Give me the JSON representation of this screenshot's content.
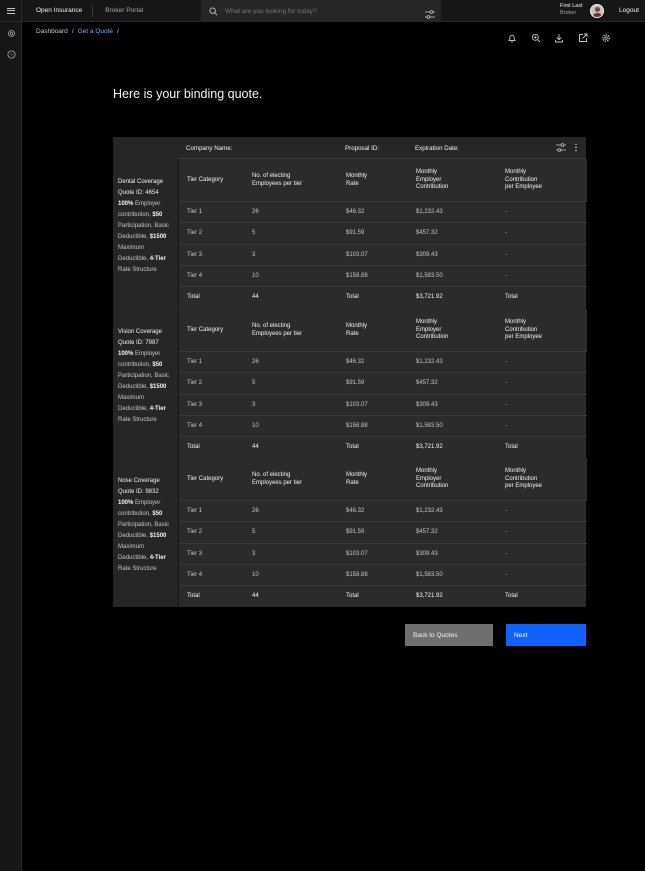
{
  "header": {
    "brand": "Open Insurance",
    "portal": "Broker Portal",
    "search_placeholder": "What are you looking for today?",
    "user_name": "First Last",
    "user_role": "Broker",
    "logout_label": "Logout"
  },
  "breadcrumb": {
    "items": [
      "Dashboard",
      "/",
      "Get a Quote",
      "/"
    ]
  },
  "page": {
    "title": "Here is your binding quote."
  },
  "quote_header": {
    "company_name": "Company Name:",
    "proposal_id": "Proposal ID:",
    "expiration_date": "Expiration Date:"
  },
  "columns": {
    "tier_category": "Tier Category",
    "employees_l1": "No. of electing",
    "employees_l2": "Employees per tier",
    "rate_l1": "Monthly",
    "rate_l2": "Rate",
    "employer_l1": "Monthly",
    "employer_l2": "Employer",
    "employer_l3": "Contribution",
    "employee_l1": "Monthly",
    "employee_l2": "Contribution",
    "employee_l3": "per Employee"
  },
  "sections": [
    {
      "name": "Dental Coverage",
      "quote_id": "Quote ID: 4654",
      "pct": "100%",
      "desc_a": " Employer contribution, ",
      "amt_a": "$50",
      "desc_b": " Participation, Basic Deductible, ",
      "amt_b": "$1500",
      "desc_c": " Maximum Deductible, ",
      "tier_struct": "4-Tier",
      "desc_d": " Rate Structure",
      "rows": [
        [
          "Tier 1",
          "26",
          "$46.32",
          "$1,232.43",
          "-"
        ],
        [
          "Tier 2",
          "5",
          "$91.59",
          "$457.32",
          "-"
        ],
        [
          "Tier 3",
          "3",
          "$103.07",
          "$309.43",
          "-"
        ],
        [
          "Tier 4",
          "10",
          "$158.88",
          "$1,583.50",
          "-"
        ]
      ],
      "total": [
        "Total",
        "44",
        "Total",
        "$3,721.92",
        "Total"
      ]
    },
    {
      "name": "Vision Coverage",
      "quote_id": "Quote ID: 7987",
      "pct": "100%",
      "desc_a": " Employer contribution, ",
      "amt_a": "$50",
      "desc_b": " Participation, Basic Deductible, ",
      "amt_b": "$1500",
      "desc_c": " Maximum Deductible, ",
      "tier_struct": "4-Tier",
      "desc_d": " Rate Structure",
      "rows": [
        [
          "Tier 1",
          "26",
          "$46.32",
          "$1,232.43",
          "-"
        ],
        [
          "Tier 2",
          "5",
          "$91.59",
          "$457.32",
          "-"
        ],
        [
          "Tier 3",
          "3",
          "$103.07",
          "$309.43",
          "-"
        ],
        [
          "Tier 4",
          "10",
          "$158.88",
          "$1,583.50",
          "-"
        ]
      ],
      "total": [
        "Total",
        "44",
        "Total",
        "$3,721.92",
        "Total"
      ]
    },
    {
      "name": "Nose Coverage",
      "quote_id": "Quote ID: 9832",
      "pct": "100%",
      "desc_a": " Employer contribution, ",
      "amt_a": "$50",
      "desc_b": " Participation, Basic Deductible, ",
      "amt_b": "$1500",
      "desc_c": " Maximum Deductible, ",
      "tier_struct": "4-Tier",
      "desc_d": " Rate Structure",
      "rows": [
        [
          "Tier 1",
          "26",
          "$46.32",
          "$1,232.43",
          "-"
        ],
        [
          "Tier 2",
          "5",
          "$91.59",
          "$457.32",
          "-"
        ],
        [
          "Tier 3",
          "3",
          "$103.07",
          "$309.43",
          "-"
        ],
        [
          "Tier 4",
          "10",
          "$158.88",
          "$1,583.50",
          "-"
        ]
      ],
      "total": [
        "Total",
        "44",
        "Total",
        "$3,721.92",
        "Total"
      ]
    }
  ],
  "actions": {
    "back_label": "Back to Quotes",
    "next_label": "Next"
  },
  "colors": {
    "primary": "#0f62fe",
    "secondary": "#6f6f6f",
    "link": "#78a9ff",
    "background": "#000000",
    "surface": "#262626"
  },
  "icons": {
    "topbar": [
      "menu-icon",
      "search-icon",
      "filter-icon",
      "avatar"
    ],
    "rail": [
      "settings-icon",
      "help-icon"
    ],
    "toolbar": [
      "notification-icon",
      "zoom-icon",
      "download-icon",
      "export-icon",
      "settings-icon"
    ],
    "table": [
      "filter-icon",
      "overflow-menu-icon"
    ]
  }
}
